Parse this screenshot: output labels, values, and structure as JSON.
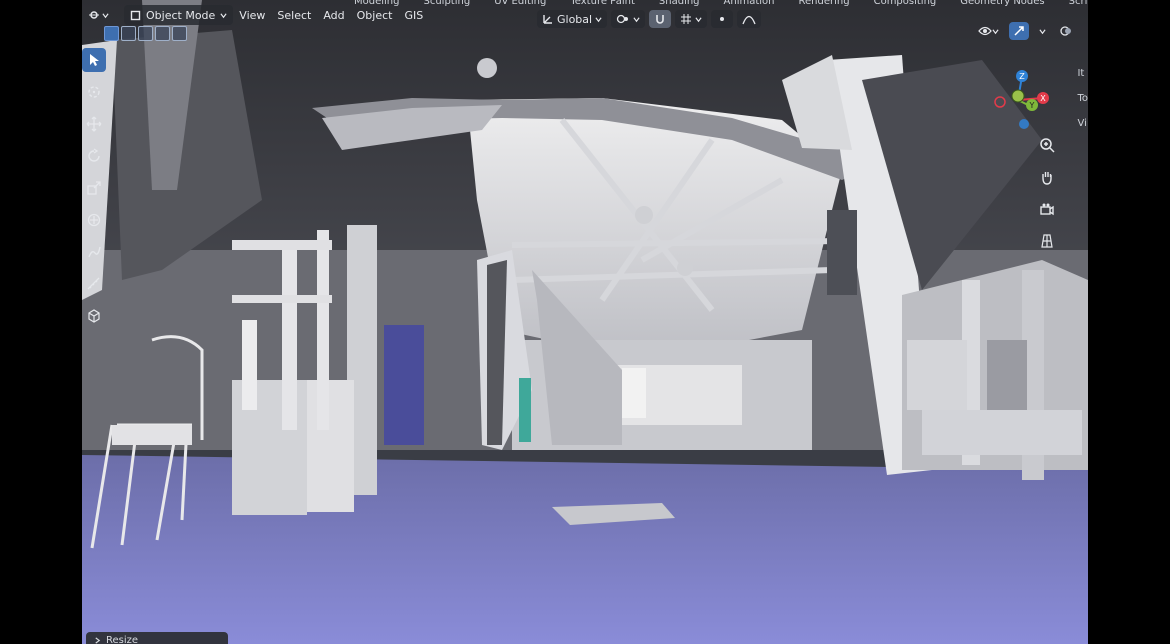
{
  "workspace_tabs": [
    "Modeling",
    "Sculpting",
    "UV Editing",
    "Texture Paint",
    "Shading",
    "Animation",
    "Rendering",
    "Compositing",
    "Geometry Nodes",
    "Scripting"
  ],
  "workspace_add": "+",
  "header": {
    "mode": "Object Mode",
    "menus": [
      "View",
      "Select",
      "Add",
      "Object",
      "GIS"
    ]
  },
  "transform": {
    "orientation": "Global"
  },
  "gizmo": {
    "z": "Z",
    "y": "Y",
    "x": "X"
  },
  "npanel_tabs": [
    "It",
    "To",
    "Vi"
  ],
  "operator_panel": {
    "label": "Resize"
  },
  "colors": {
    "floor": "#7d7fc8",
    "ceiling": "#3b3c42",
    "structure": "#d9d9dc",
    "accent": "#3e6fb0",
    "axis_x": "#e23b4a",
    "axis_y": "#7fb83a",
    "axis_z": "#2f83d8"
  },
  "icons": [
    "editor-type-icon",
    "object-mode-icon",
    "select-box-icon",
    "cursor-icon",
    "move-icon",
    "rotate-icon",
    "scale-icon",
    "transform-icon",
    "annotate-icon",
    "measure-icon",
    "add-cube-icon",
    "transform-orientation-icon",
    "pivot-icon",
    "snap-icon",
    "proportional-edit-icon",
    "visibility-icon",
    "gizmo-toggle-icon",
    "overlay-icon",
    "zoom-icon",
    "pan-hand-icon",
    "camera-icon",
    "grid-view-icon"
  ]
}
